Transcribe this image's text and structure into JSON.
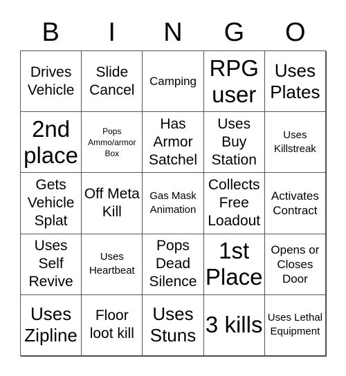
{
  "header": {
    "letters": [
      "B",
      "I",
      "N",
      "G",
      "O"
    ]
  },
  "card": {
    "rows": [
      [
        "Drives Vehicle",
        "Slide Cancel",
        "Camping",
        "RPG user",
        "Uses Plates"
      ],
      [
        "2nd place",
        "Pops Ammo/armor Box",
        "Has Armor Satchel",
        "Uses Buy Station",
        "Uses Killstreak"
      ],
      [
        "Gets Vehicle Splat",
        "Off Meta Kill",
        "Gas Mask Animation",
        "Collects Free Loadout",
        "Activates Contract"
      ],
      [
        "Uses Self Revive",
        "Uses Heartbeat",
        "Pops Dead Silence",
        "1st Place",
        "Opens or Closes Door"
      ],
      [
        "Uses Zipline",
        "Floor loot kill",
        "Uses Stuns",
        "3 kills",
        "Uses Lethal Equipment"
      ]
    ]
  }
}
